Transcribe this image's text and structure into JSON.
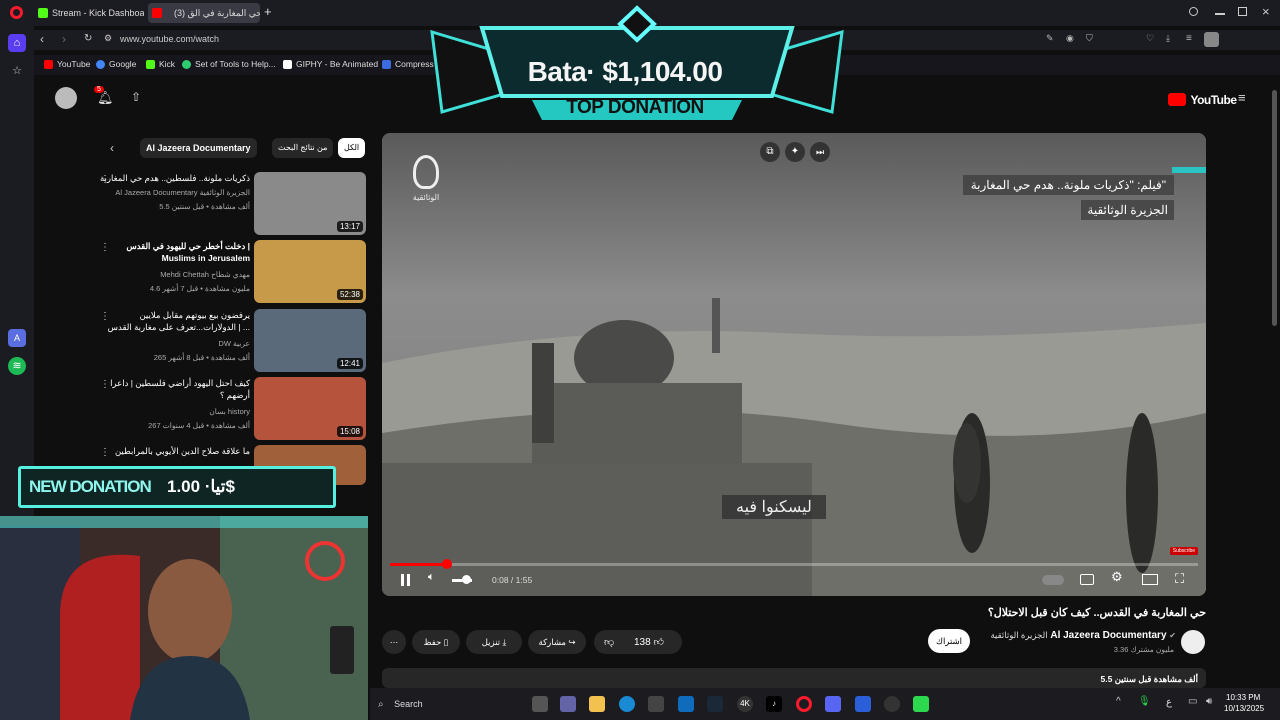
{
  "browser": {
    "tabs": [
      {
        "label": "Stream - Kick Dashboard",
        "color": "#53fc18"
      },
      {
        "label": "(3) حي المغاربة في الق",
        "color": "#ff0000"
      }
    ],
    "new_tab": "+",
    "url": "www.youtube.com/watch",
    "bookmarks": [
      {
        "label": "YouTube",
        "color": "#ff0000"
      },
      {
        "label": "Google",
        "color": "#4285f4"
      },
      {
        "label": "Kick",
        "color": "#53fc18"
      },
      {
        "label": "Set of Tools to Help...",
        "color": "#2ecc71"
      },
      {
        "label": "GIPHY - Be Animated",
        "color": "#ffffff"
      },
      {
        "label": "Compress Images",
        "color": "#3b6de0"
      }
    ]
  },
  "overlay": {
    "top_donation_amount": "Bata· $1,104.00",
    "top_donation_label": "TOP DONATION",
    "new_donation_label": "NEW DONATION",
    "new_donation_value": "تيا· 1.00$"
  },
  "youtube": {
    "logo": "YouTube",
    "notif_count": "5",
    "chips": [
      "الكل",
      "من نتائج البحث",
      "Al Jazeera Documentary"
    ],
    "recommendations": [
      {
        "title": "ذكريات ملونة.. فلسطين.. هدم حي المغاربة",
        "channel": "Al Jazeera Documentary الجزيرة الوثائقية",
        "meta": "5.5 ألف مشاهدة • قبل سنتين",
        "duration": "13:17",
        "thumb": "#8a8a8a"
      },
      {
        "title": "دخلت أخطر حي لليهود في القدس | Muslims in Jerusalem",
        "channel": "Mehdi Chettah مهدي شطاح",
        "meta": "4.6 مليون مشاهدة • قبل 7 أشهر",
        "duration": "52:38",
        "thumb": "#c79a4a"
      },
      {
        "title": "يرفضون بيع بيوتهم مقابل ملايين الدولارات...تعرف على مغاربة القدس | ...",
        "channel": "DW عربية",
        "meta": "265 ألف مشاهدة • قبل 8 أشهر",
        "duration": "12:41",
        "thumb": "#5a6a7a"
      },
      {
        "title": "كيف احتل اليهود أراضي فلسطين | داعرا أرضهم ؟",
        "channel": "بسان history",
        "meta": "267 ألف مشاهدة • قبل 4 سنوات",
        "duration": "15:08",
        "thumb": "#b5533c"
      },
      {
        "title": "ما علاقة صلاح الدين الأيوبي بالمرابطين",
        "channel": "",
        "meta": "",
        "duration": "",
        "thumb": "#a0603a"
      }
    ],
    "video": {
      "caption_line1": "فيلم: \"ذكريات ملونة.. هدم حي المغاربة\"",
      "caption_line2": "الجزيرة الوثائقية",
      "channel_logo_text": "الوثائقية",
      "subtitle": "ليسكنوا فيه",
      "time": "0:08 / 1:55",
      "progress": 0.07,
      "subscribe_badge": "Subscribe"
    },
    "title": "حي المغاربة في القدس.. كيف كان قبل الاحتلال؟",
    "channel_name": "Al Jazeera Documentary",
    "channel_name_ar": "الجزيرة الوثائقية",
    "subscribers": "3.36 مليون مشترك",
    "subscribe_button": "اشتراك",
    "likes": "138",
    "share": "مشاركة",
    "download": "تنزيل",
    "save": "حفظ",
    "views_date": "5.5 ألف مشاهدة قبل سنتين"
  },
  "taskbar": {
    "search": "Search",
    "time": "10:33 PM",
    "date": "10/13/2025",
    "lang": "ع"
  }
}
